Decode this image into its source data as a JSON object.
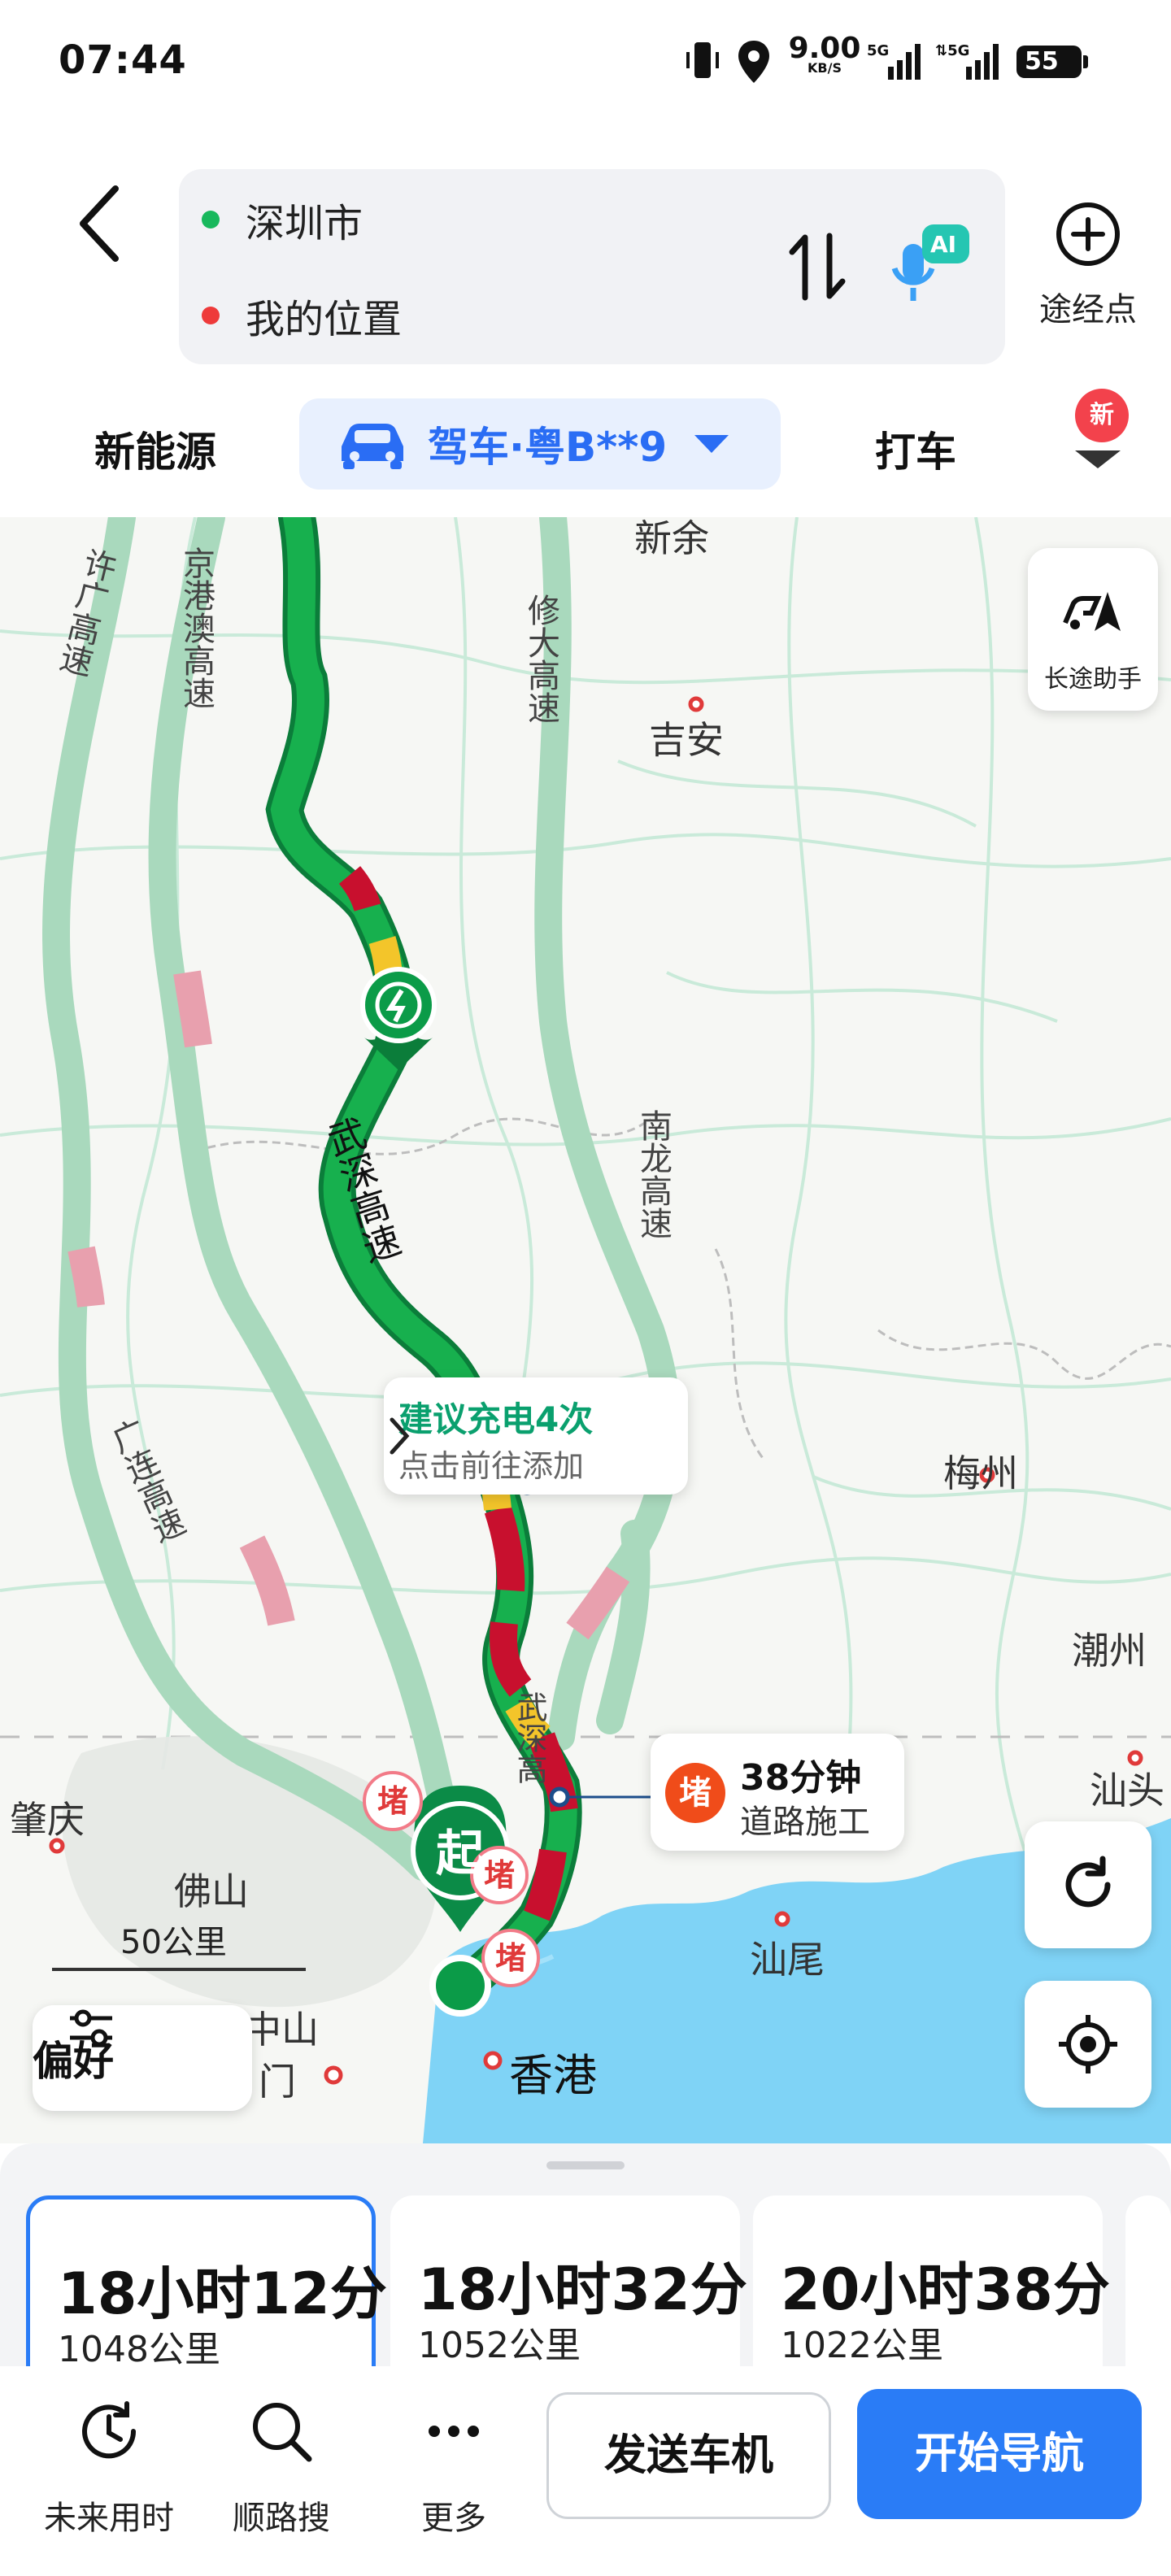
{
  "status_bar": {
    "time": "07:44",
    "net_speed_value": "9.00",
    "net_speed_unit": "KB/S",
    "signal_1": "5G",
    "signal_2": "5G",
    "battery": "55"
  },
  "route": {
    "origin": "深圳市",
    "destination": "我的位置",
    "waypoint_label": "途经点",
    "ai_badge": "AI"
  },
  "modes": {
    "new_energy": "新能源",
    "drive": "驾车·粤B**9",
    "taxi": "打车",
    "new_badge": "新"
  },
  "map": {
    "labels": {
      "xinyu": "新余",
      "jian": "吉安",
      "meizhou": "梅州",
      "chaozhou": "潮州",
      "shantou": "汕头",
      "zhaoqing": "肇庆",
      "foshan": "佛山",
      "zhongshan": "中山",
      "jiangmen": "门",
      "hongkong": "香港",
      "shanwei": "汕尾"
    },
    "highways": {
      "xuguang": "许广高速",
      "jinggangao": "京港澳高速",
      "xiuda": "修大高速",
      "nanlong": "南龙高速",
      "wushen": "武深高速",
      "guanglian": "广连高速",
      "wushen_2": "武深高"
    },
    "long_trip_label": "长途助手",
    "charge_title": "建议充电4次",
    "charge_sub": "点击前往添加",
    "jam_badge": "堵",
    "jam_duration": "38分钟",
    "jam_reason": "道路施工",
    "jam_marker_1": "堵",
    "jam_marker_2": "堵",
    "jam_marker_3": "堵",
    "start_marker": "起",
    "scale": "50公里",
    "preference": "偏好"
  },
  "routes": [
    {
      "time": "18小时12分",
      "distance": "1048公里"
    },
    {
      "time": "18小时32分",
      "distance": "1052公里"
    },
    {
      "time": "20小时38分",
      "distance": "1022公里"
    }
  ],
  "actions": {
    "future_time": "未来用时",
    "along_search": "顺路搜",
    "more": "更多",
    "send_to_car": "发送车机",
    "start_nav": "开始导航"
  },
  "colors": {
    "accent": "#2a7cf6",
    "route_green": "#14a44a",
    "jam_red": "#c8102e",
    "water": "#7fd3f6"
  }
}
